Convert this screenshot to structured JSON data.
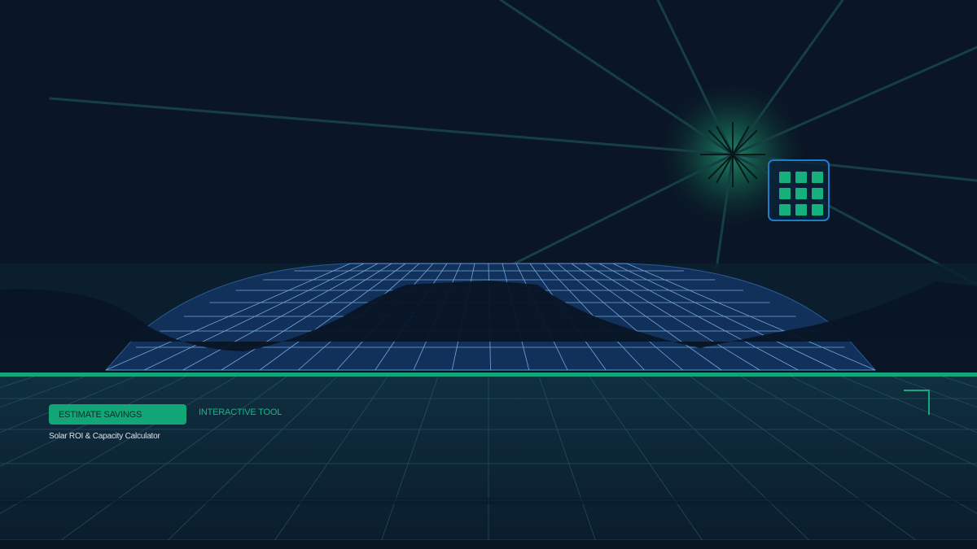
{
  "hero": {
    "cta_label": "ESTIMATE SAVINGS",
    "tag_label": "INTERACTIVE TOOL",
    "subtitle": "Solar ROI & Capacity Calculator"
  },
  "icons": {
    "sun": "sun-icon",
    "app_grid": "grid-menu-icon",
    "corner_bracket": "corner-bracket-icon"
  },
  "colors": {
    "background": "#0a1626",
    "accent_green": "#12a677",
    "accent_blue": "#1f7ccb",
    "panel_blue": "#11305a",
    "horizon_line": "#15a57a"
  }
}
